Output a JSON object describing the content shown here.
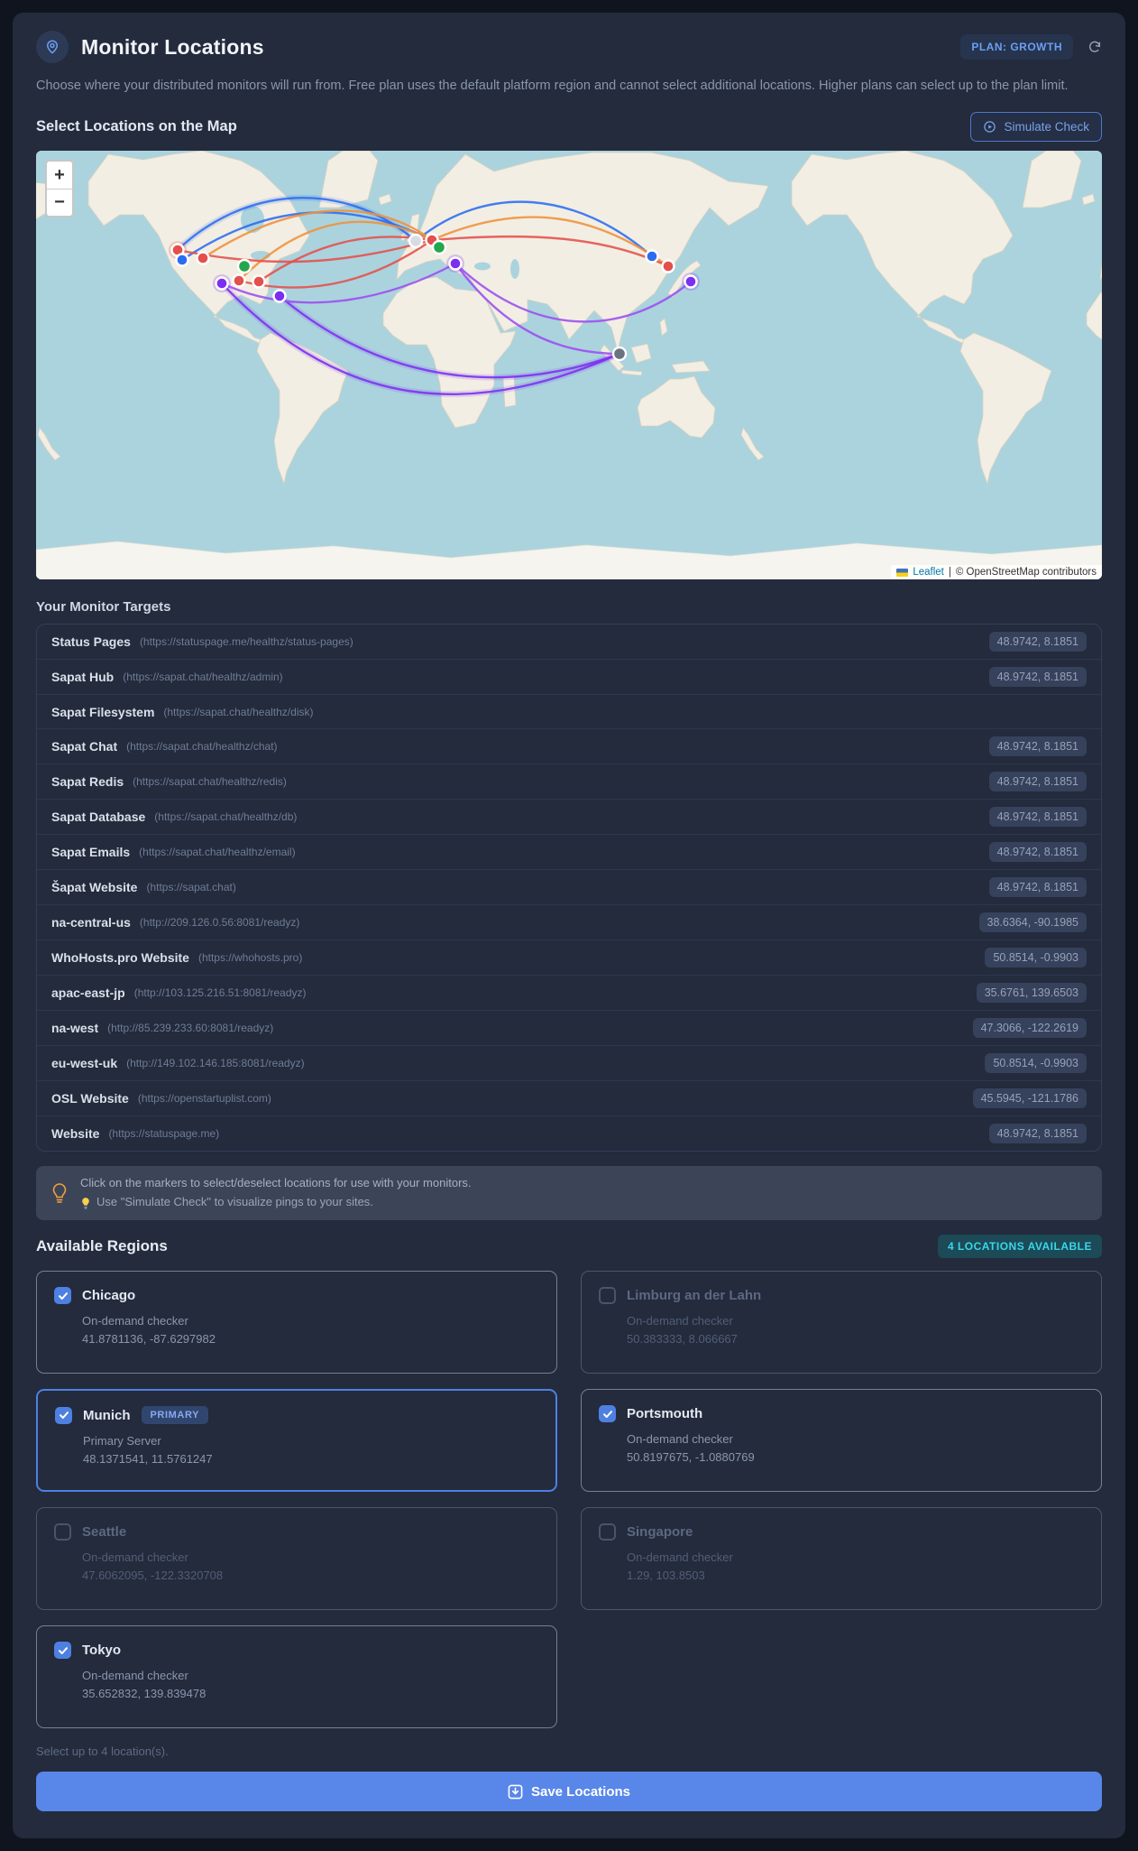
{
  "header": {
    "title": "Monitor Locations",
    "plan_badge": "PLAN: GROWTH",
    "description": "Choose where your distributed monitors will run from. Free plan uses the default platform region and cannot select additional locations. Higher plans can select up to the plan limit."
  },
  "map_section": {
    "heading": "Select Locations on the Map",
    "simulate_button": "Simulate Check",
    "zoom_in": "+",
    "zoom_out": "−",
    "attribution": {
      "leaflet": "Leaflet",
      "divider": "|",
      "osm": "© OpenStreetMap contributors"
    }
  },
  "targets": {
    "heading": "Your Monitor Targets",
    "items": [
      {
        "name": "Status Pages",
        "url": "(https://statuspage.me/healthz/status-pages)",
        "coords": "48.9742, 8.1851"
      },
      {
        "name": "Sapat Hub",
        "url": "(https://sapat.chat/healthz/admin)",
        "coords": "48.9742, 8.1851"
      },
      {
        "name": "Sapat Filesystem",
        "url": "(https://sapat.chat/healthz/disk)",
        "coords": ""
      },
      {
        "name": "Sapat Chat",
        "url": "(https://sapat.chat/healthz/chat)",
        "coords": "48.9742, 8.1851"
      },
      {
        "name": "Sapat Redis",
        "url": "(https://sapat.chat/healthz/redis)",
        "coords": "48.9742, 8.1851"
      },
      {
        "name": "Sapat Database",
        "url": "(https://sapat.chat/healthz/db)",
        "coords": "48.9742, 8.1851"
      },
      {
        "name": "Sapat Emails",
        "url": "(https://sapat.chat/healthz/email)",
        "coords": "48.9742, 8.1851"
      },
      {
        "name": "Šapat Website",
        "url": "(https://sapat.chat)",
        "coords": "48.9742, 8.1851"
      },
      {
        "name": "na-central-us",
        "url": "(http://209.126.0.56:8081/readyz)",
        "coords": "38.6364, -90.1985"
      },
      {
        "name": "WhoHosts.pro Website",
        "url": "(https://whohosts.pro)",
        "coords": "50.8514, -0.9903"
      },
      {
        "name": "apac-east-jp",
        "url": "(http://103.125.216.51:8081/readyz)",
        "coords": "35.6761, 139.6503"
      },
      {
        "name": "na-west",
        "url": "(http://85.239.233.60:8081/readyz)",
        "coords": "47.3066, -122.2619"
      },
      {
        "name": "eu-west-uk",
        "url": "(http://149.102.146.185:8081/readyz)",
        "coords": "50.8514, -0.9903"
      },
      {
        "name": "OSL Website",
        "url": "(https://openstartuplist.com)",
        "coords": "45.5945, -121.1786"
      },
      {
        "name": "Website",
        "url": "(https://statuspage.me)",
        "coords": "48.9742, 8.1851"
      }
    ]
  },
  "tip": {
    "line1": "Click on the markers to select/deselect locations for use with your monitors.",
    "line2": "Use \"Simulate Check\" to visualize pings to your sites."
  },
  "regions": {
    "heading": "Available Regions",
    "badge": "4 LOCATIONS AVAILABLE",
    "cards": [
      {
        "name": "Chicago",
        "sub": "On-demand checker",
        "coords": "41.8781136, -87.6297982",
        "checked": true
      },
      {
        "name": "Limburg an der Lahn",
        "sub": "On-demand checker",
        "coords": "50.383333, 8.066667",
        "checked": false
      },
      {
        "name": "Munich",
        "primary_label": "PRIMARY",
        "sub": "Primary Server",
        "coords": "48.1371541, 11.5761247",
        "checked": true,
        "primary": true
      },
      {
        "name": "Portsmouth",
        "sub": "On-demand checker",
        "coords": "50.8197675, -1.0880769",
        "checked": true
      },
      {
        "name": "Seattle",
        "sub": "On-demand checker",
        "coords": "47.6062095, -122.3320708",
        "checked": false
      },
      {
        "name": "Singapore",
        "sub": "On-demand checker",
        "coords": "1.29, 103.8503",
        "checked": false
      },
      {
        "name": "Tokyo",
        "sub": "On-demand checker",
        "coords": "35.652832, 139.839478",
        "checked": true
      }
    ],
    "footer_note": "Select up to 4 location(s).",
    "save_button": "Save Locations"
  },
  "colors": {
    "accent_blue": "#5886e9",
    "badge_cyan": "#38d6ea",
    "primary_border": "#4e80e1",
    "marker_red": "#e4504b",
    "marker_blue": "#2b6cf0",
    "marker_purple": "#7b2ff0",
    "marker_green": "#22a74f",
    "marker_gray": "#6b7280",
    "ocean": "#abd3de",
    "land": "#f2eee3"
  }
}
